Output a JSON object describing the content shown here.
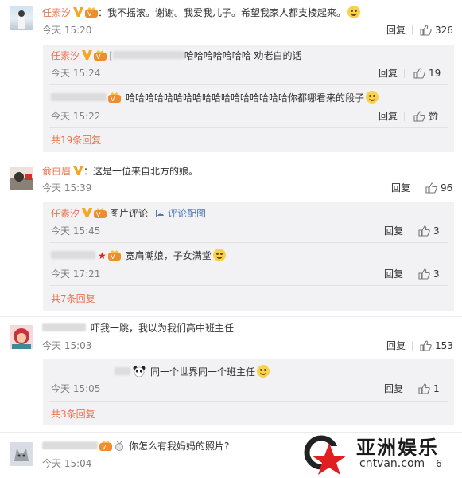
{
  "reply_label": "回复",
  "comments": [
    {
      "name": "任素汐",
      "text": "：我不摇滚。谢谢。我爱我儿子。希望我家人都支棱起来。",
      "time": "今天 15:20",
      "likes": "326",
      "replies": [
        {
          "name": "任素汐",
          "text": "哈哈哈哈哈哈哈 劝老白的话",
          "time": "今天 15:24",
          "likes": "19"
        },
        {
          "name": "",
          "text": "哈哈哈哈哈哈哈哈哈哈哈哈哈哈哈哈哈你都哪看来的段子",
          "time": "今天 15:22",
          "likes": "赞"
        }
      ],
      "more": "共19条回复"
    },
    {
      "name": "俞白眉",
      "text": "：这是一位来自北方的娘。",
      "time": "今天 15:39",
      "likes": "96",
      "replies": [
        {
          "name": "任素汐",
          "text": "图片评论",
          "link": "评论配图",
          "time": "今天 15:45",
          "likes": "3"
        },
        {
          "name": "",
          "text": "宽肩潮娘，子女满堂",
          "time": "今天 17:21",
          "likes": "3"
        }
      ],
      "more": "共7条回复"
    },
    {
      "name": "",
      "text": "吓我一跳，我以为我们高中班主任",
      "time": "今天 15:03",
      "likes": "153",
      "replies": [
        {
          "name": "",
          "text": "同一个世界同一个班主任",
          "time": "今天 15:05",
          "likes": "1"
        }
      ],
      "more": "共3条回复"
    },
    {
      "name": "",
      "text": "你怎么有我妈妈的照片?",
      "time": "今天 15:04",
      "likes": "6"
    }
  ],
  "watermark": {
    "name": "亚洲娱乐",
    "url": "cntvan.com"
  },
  "colors": {
    "name": "#eb7350",
    "reply_bg": "#f2f2f5",
    "watermark_red": "#e02020"
  }
}
